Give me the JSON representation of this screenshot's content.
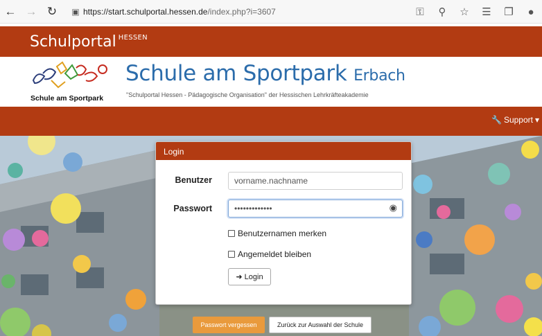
{
  "browser": {
    "url_host": "https://start.schulportal.hessen.de",
    "url_path": "/index.php?i=3607"
  },
  "portal": {
    "brand": "Schulportal",
    "brand_sup": "HESSEN"
  },
  "school": {
    "logo_caption": "Schule am Sportpark",
    "name": "Schule am Sportpark",
    "city": "Erbach",
    "subtitle": "\"Schulportal Hessen - Pädagogische Organisation\" der Hessischen Lehrkräfteakademie"
  },
  "nav": {
    "support": "Support"
  },
  "login": {
    "title": "Login",
    "user_label": "Benutzer",
    "user_placeholder": "vorname.nachname",
    "password_label": "Passwort",
    "password_value": "•••••••••••••",
    "remember_user": "Benutzernamen merken",
    "stay_logged_in": "Angemeldet bleiben",
    "login_button": "Login"
  },
  "footer_buttons": {
    "forgot": "Passwort vergessen",
    "back": "Zurück zur Auswahl der Schule"
  },
  "colors": {
    "brand": "#b23b12",
    "school_name": "#2b6cab",
    "forgot_button": "#e99a3c"
  }
}
